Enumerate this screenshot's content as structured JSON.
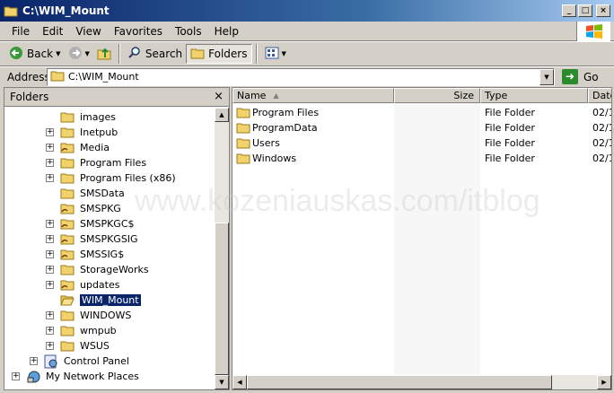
{
  "window": {
    "title": "C:\\WIM_Mount",
    "buttons": {
      "minimize": "_",
      "maximize": "□",
      "close": "×"
    }
  },
  "menu": [
    "File",
    "Edit",
    "View",
    "Favorites",
    "Tools",
    "Help"
  ],
  "toolbar": {
    "back_label": "Back",
    "search_label": "Search",
    "folders_label": "Folders"
  },
  "address": {
    "label": "Address",
    "value": "C:\\WIM_Mount",
    "go_label": "Go"
  },
  "folders_pane": {
    "title": "Folders",
    "close": "×",
    "items": [
      {
        "label": "images",
        "expandable": false,
        "indent": 2,
        "icon": "folder-icon"
      },
      {
        "label": "Inetpub",
        "expandable": true,
        "indent": 2,
        "icon": "folder-icon"
      },
      {
        "label": "Media",
        "expandable": true,
        "indent": 2,
        "icon": "folder-shared-icon"
      },
      {
        "label": "Program Files",
        "expandable": true,
        "indent": 2,
        "icon": "folder-icon"
      },
      {
        "label": "Program Files (x86)",
        "expandable": true,
        "indent": 2,
        "icon": "folder-icon"
      },
      {
        "label": "SMSData",
        "expandable": false,
        "indent": 2,
        "icon": "folder-icon"
      },
      {
        "label": "SMSPKG",
        "expandable": false,
        "indent": 2,
        "icon": "folder-shared-icon"
      },
      {
        "label": "SMSPKGC$",
        "expandable": true,
        "indent": 2,
        "icon": "folder-shared-icon"
      },
      {
        "label": "SMSPKGSIG",
        "expandable": true,
        "indent": 2,
        "icon": "folder-shared-icon"
      },
      {
        "label": "SMSSIG$",
        "expandable": true,
        "indent": 2,
        "icon": "folder-shared-icon"
      },
      {
        "label": "StorageWorks",
        "expandable": true,
        "indent": 2,
        "icon": "folder-icon"
      },
      {
        "label": "updates",
        "expandable": true,
        "indent": 2,
        "icon": "folder-shared-icon"
      },
      {
        "label": "WIM_Mount",
        "expandable": false,
        "indent": 2,
        "icon": "folder-open-icon",
        "selected": true
      },
      {
        "label": "WINDOWS",
        "expandable": true,
        "indent": 2,
        "icon": "folder-icon"
      },
      {
        "label": "wmpub",
        "expandable": true,
        "indent": 2,
        "icon": "folder-icon"
      },
      {
        "label": "WSUS",
        "expandable": true,
        "indent": 2,
        "icon": "folder-icon"
      },
      {
        "label": "Control Panel",
        "expandable": true,
        "indent": 1,
        "icon": "control-panel-icon"
      },
      {
        "label": "My Network Places",
        "expandable": true,
        "indent": 0,
        "icon": "network-places-icon"
      }
    ]
  },
  "file_list": {
    "columns": [
      "Name",
      "Size",
      "Type",
      "Date"
    ],
    "rows": [
      {
        "name": "Program Files",
        "size": "",
        "type": "File Folder",
        "date": "02/1"
      },
      {
        "name": "ProgramData",
        "size": "",
        "type": "File Folder",
        "date": "02/1"
      },
      {
        "name": "Users",
        "size": "",
        "type": "File Folder",
        "date": "02/1"
      },
      {
        "name": "Windows",
        "size": "",
        "type": "File Folder",
        "date": "02/1"
      }
    ]
  },
  "watermark": "www.kozeniauskas.com/itblog"
}
